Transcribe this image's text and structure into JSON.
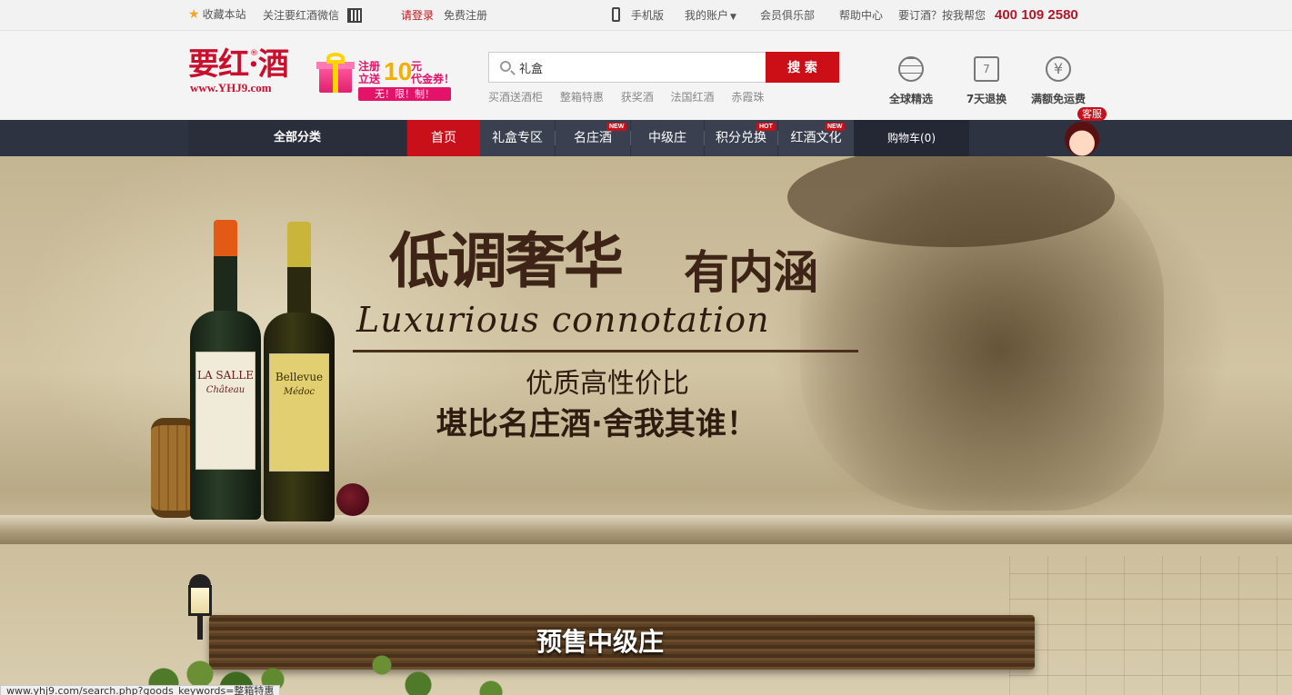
{
  "topbar": {
    "favorite": "收藏本站",
    "wechat": "关注要红酒微信",
    "login": "请登录",
    "register": "免费注册",
    "mobile": "手机版",
    "account": "我的账户",
    "club": "会员俱乐部",
    "help": "帮助中心",
    "order_hint": "要订酒？按我帮您",
    "hotline": "400 109 2580"
  },
  "header": {
    "logo_text": "要红·酒",
    "logo_reg": "®",
    "logo_url": "www.YHJ9.com",
    "promo": {
      "line1": "注册",
      "line2": "立送",
      "amount": "10",
      "line3": "元",
      "line4": "代金券！",
      "tag": "无！限！制！"
    },
    "search": {
      "value": "礼盒",
      "button": "搜 索"
    },
    "hotwords": [
      "买酒送酒柜",
      "整箱特惠",
      "获奖酒",
      "法国红酒",
      "赤霞珠"
    ],
    "features": [
      {
        "icon": "globe",
        "label": "全球精选"
      },
      {
        "icon": "calendar",
        "glyph": "7",
        "label": "7天退换"
      },
      {
        "icon": "yen",
        "glyph": "¥",
        "label": "满额免运费"
      }
    ]
  },
  "nav": {
    "all_categories": "全部分类",
    "items": [
      {
        "label": "首页",
        "badge": ""
      },
      {
        "label": "礼盒专区",
        "badge": ""
      },
      {
        "label": "名庄酒",
        "badge": "NEW"
      },
      {
        "label": "中级庄",
        "badge": ""
      },
      {
        "label": "积分兑换",
        "badge": "HOT"
      },
      {
        "label": "红酒文化",
        "badge": "NEW"
      }
    ],
    "cart": "购物车(0)",
    "service": "客服"
  },
  "banner": {
    "title_cn_1": "低调奢华",
    "title_cn_2": "有内涵",
    "title_en": "Luxurious connotation",
    "sub_1": "优质高性价比",
    "sub_2": "堪比名庄酒·舍我其谁！",
    "bottle1_label": "LA SALLE",
    "bottle1_sub": "Château",
    "bottle2_label": "Bellevue",
    "bottle2_sub": "Médoc",
    "section_title": "预售中级庄"
  },
  "status_url": "www.yhj9.com/search.php?goods_keywords=整箱特惠",
  "colors": {
    "brand_red": "#c8101b",
    "nav_bg": "#2e3341"
  }
}
